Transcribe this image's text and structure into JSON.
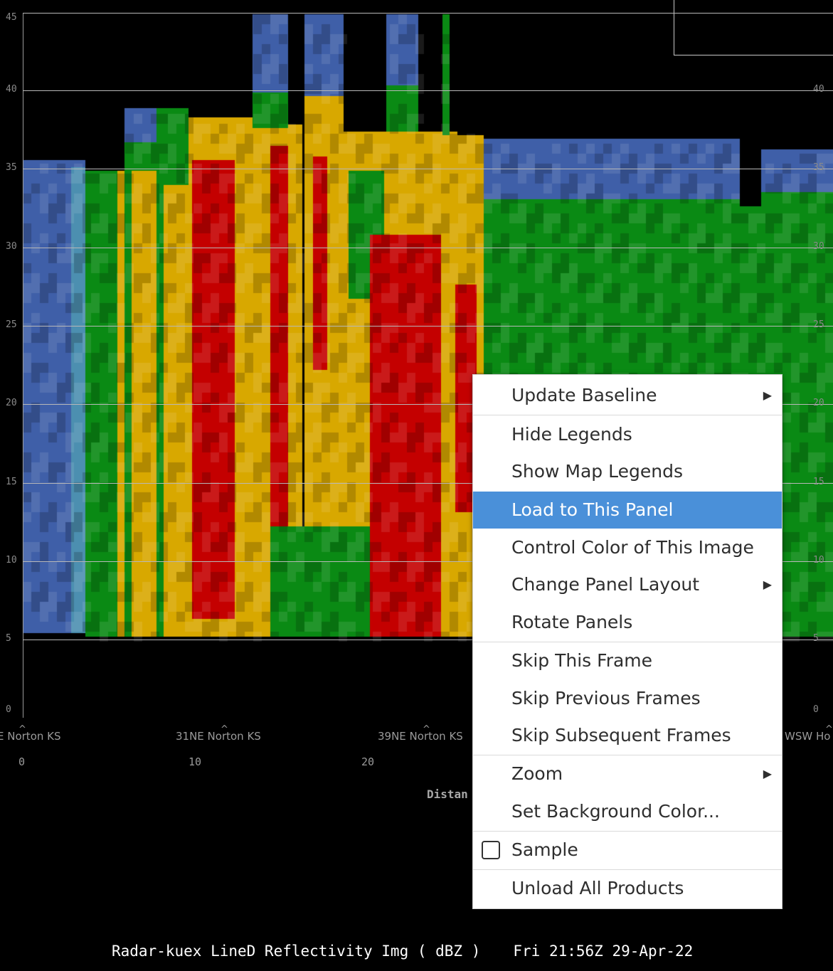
{
  "y_axis": {
    "ticks": [
      "45",
      "40",
      "35",
      "30",
      "25",
      "20",
      "15",
      "10",
      "5",
      "0"
    ]
  },
  "locations": {
    "left": "E Norton KS",
    "mid": "31NE Norton KS",
    "right_cut": "39NE Norton KS",
    "far_right": "WSW Ho"
  },
  "distance_ticks": [
    "0",
    "10",
    "20"
  ],
  "x_axis_title": "Distan",
  "status": {
    "product": "Radar-kuex LineD Reflectivity Img ( dBZ )",
    "timestamp": "Fri 21:56Z 29-Apr-22"
  },
  "context_menu": {
    "items": [
      {
        "label": "Update Baseline",
        "submenu": true
      },
      {
        "label": "Hide Legends"
      },
      {
        "label": "Show Map Legends"
      },
      {
        "label": "Load to This Panel",
        "highlighted": true
      },
      {
        "label": "Control Color of This Image"
      },
      {
        "label": "Change Panel Layout",
        "submenu": true
      },
      {
        "label": "Rotate Panels"
      },
      {
        "label": "Skip This Frame"
      },
      {
        "label": "Skip Previous Frames"
      },
      {
        "label": "Skip Subsequent Frames"
      },
      {
        "label": "Zoom",
        "submenu": true
      },
      {
        "label": "Set Background Color..."
      },
      {
        "label": "Sample",
        "checkbox": true,
        "checked": false
      },
      {
        "label": "Unload All Products"
      }
    ],
    "submenu_arrow": "▶"
  },
  "colors": {
    "background": "#000000",
    "menu_highlight": "#4a90d9",
    "dbz_red": "#c40000",
    "dbz_yellow": "#d8a800",
    "dbz_green": "#0a8a14",
    "dbz_blue": "#3f5fa8"
  }
}
